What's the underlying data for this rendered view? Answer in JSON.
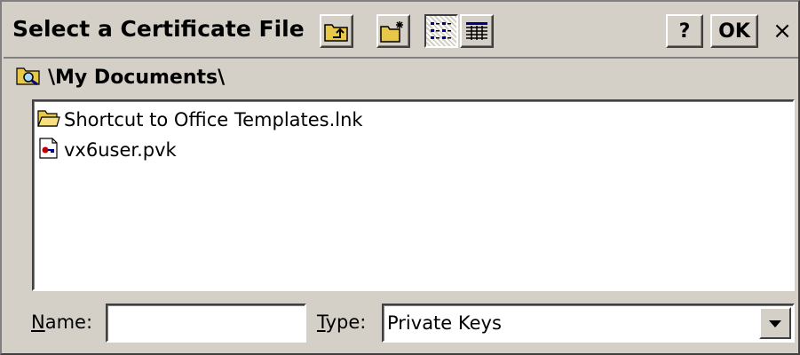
{
  "dialog": {
    "title": "Select a Certificate File",
    "help_label": "?",
    "ok_label": "OK",
    "close_label": "×"
  },
  "toolbar": {
    "icons": [
      "up-folder-icon",
      "new-folder-icon",
      "list-view-icon",
      "details-view-icon"
    ],
    "active_view": "list"
  },
  "path": {
    "icon": "folder-search-icon",
    "text": "\\My Documents\\"
  },
  "files": [
    {
      "name": "Shortcut to Office Templates.lnk",
      "icon": "folder-open-icon"
    },
    {
      "name": "vx6user.pvk",
      "icon": "key-file-icon"
    }
  ],
  "form": {
    "name_label_prefix": "N",
    "name_label_rest": "ame:",
    "name_value": "",
    "type_label_prefix": "T",
    "type_label_rest": "ype:",
    "type_value": "Private Keys"
  },
  "colors": {
    "face": "#d4d0c8",
    "shadow": "#808080",
    "dark_shadow": "#404040",
    "highlight": "#ffffff",
    "folder_yellow": "#e8c848"
  }
}
